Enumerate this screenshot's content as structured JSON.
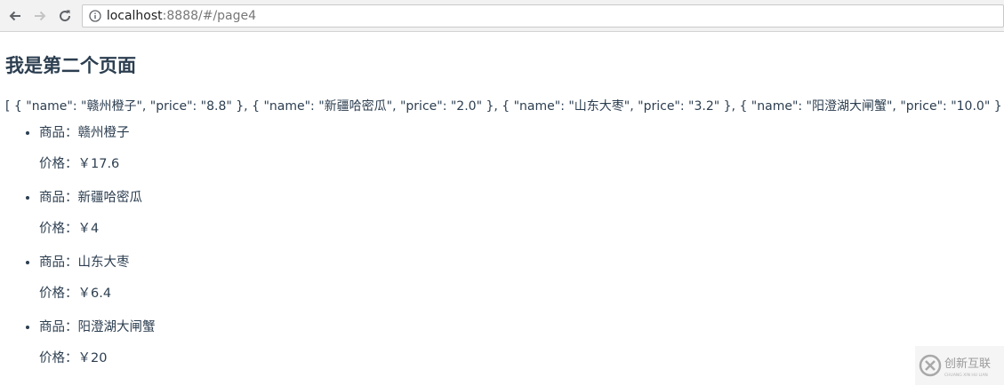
{
  "browser": {
    "url_host": "localhost",
    "url_rest": ":8888/#/page4"
  },
  "page": {
    "title": "我是第二个页面",
    "json_text": "[ { \"name\": \"赣州橙子\", \"price\": \"8.8\" }, { \"name\": \"新疆哈密瓜\", \"price\": \"2.0\" }, { \"name\": \"山东大枣\", \"price\": \"3.2\" }, { \"name\": \"阳澄湖大闸蟹\", \"price\": \"10.0\" } ]",
    "items": [
      {
        "name": "商品：赣州橙子",
        "price": "价格：￥17.6"
      },
      {
        "name": "商品：新疆哈密瓜",
        "price": "价格：￥4"
      },
      {
        "name": "商品：山东大枣",
        "price": "价格：￥6.4"
      },
      {
        "name": "商品：阳澄湖大闸蟹",
        "price": "价格：￥20"
      }
    ]
  },
  "watermark": {
    "logo_text": "创新互联",
    "logo_subtext": "CHUANG XIN HU LIAN"
  }
}
